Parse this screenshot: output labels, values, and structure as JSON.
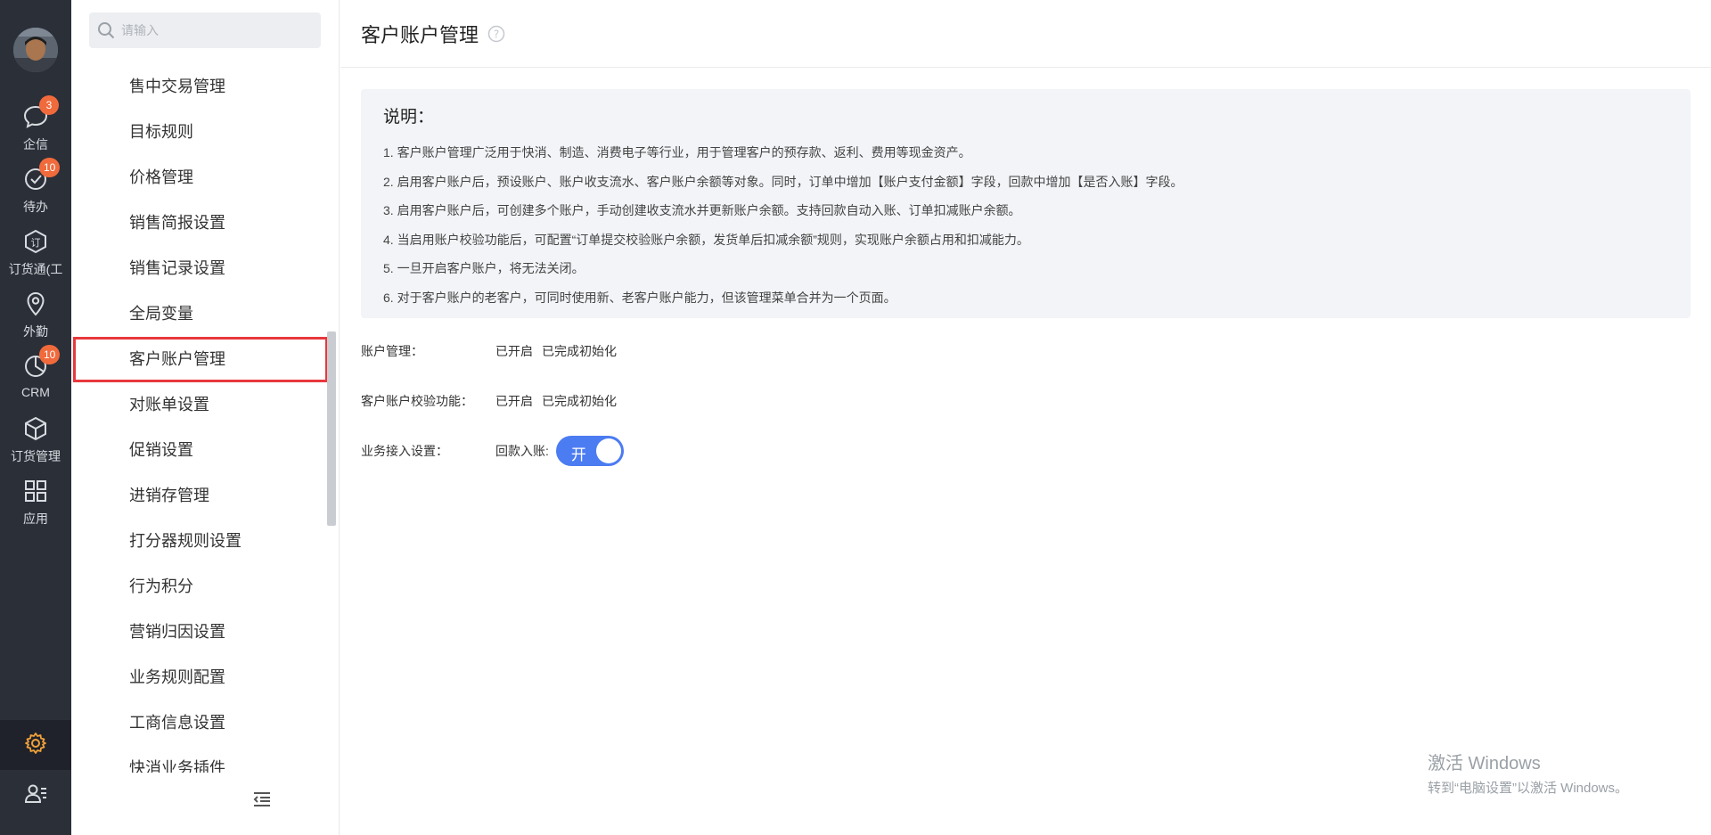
{
  "rail": {
    "items": [
      {
        "label": "企信",
        "badge": "3"
      },
      {
        "label": "待办",
        "badge": "10"
      },
      {
        "label": "订货通(工",
        "badge": ""
      },
      {
        "label": "外勤",
        "badge": ""
      },
      {
        "label": "CRM",
        "badge": "10"
      },
      {
        "label": "订货管理",
        "badge": ""
      },
      {
        "label": "应用",
        "badge": ""
      }
    ],
    "settings_icon_color": "#f2a23a"
  },
  "submenu": {
    "search_placeholder": "请输入",
    "items": [
      "售中交易管理",
      "目标规则",
      "价格管理",
      "销售简报设置",
      "销售记录设置",
      "全局变量",
      "客户账户管理",
      "对账单设置",
      "促销设置",
      "进销存管理",
      "打分器规则设置",
      "行为积分",
      "营销归因设置",
      "业务规则配置",
      "工商信息设置",
      "快消业务插件"
    ],
    "active_index": 6
  },
  "main": {
    "title": "客户账户管理",
    "notice": {
      "title": "说明：",
      "lines": [
        "1. 客户账户管理广泛用于快消、制造、消费电子等行业，用于管理客户的预存款、返利、费用等现金资产。",
        "2. 启用客户账户后，预设账户、账户收支流水、客户账户余额等对象。同时，订单中增加【账户支付金额】字段，回款中增加【是否入账】字段。",
        "3. 启用客户账户后，可创建多个账户，手动创建收支流水并更新账户余额。支持回款自动入账、订单扣减账户余额。",
        "4. 当启用账户校验功能后，可配置“订单提交校验账户余额，发货单后扣减余额”规则，实现账户余额占用和扣减能力。",
        "5. 一旦开启客户账户，将无法关闭。",
        "6. 对于客户账户的老客户，可同时使用新、老客户账户能力，但该管理菜单合并为一个页面。"
      ]
    },
    "settings": {
      "account": {
        "label": "账户管理：",
        "status": "已开启",
        "init": "已完成初始化"
      },
      "verify": {
        "label": "客户账户校验功能：",
        "status": "已开启",
        "init": "已完成初始化"
      },
      "business": {
        "label": "业务接入设置：",
        "sub_label": "回款入账:",
        "toggle_text": "开",
        "toggle_on": true
      }
    },
    "accent_color": "#4c7cf2"
  },
  "watermark": {
    "title": "激活 Windows",
    "subtitle": "转到“电脑设置”以激活 Windows。"
  }
}
